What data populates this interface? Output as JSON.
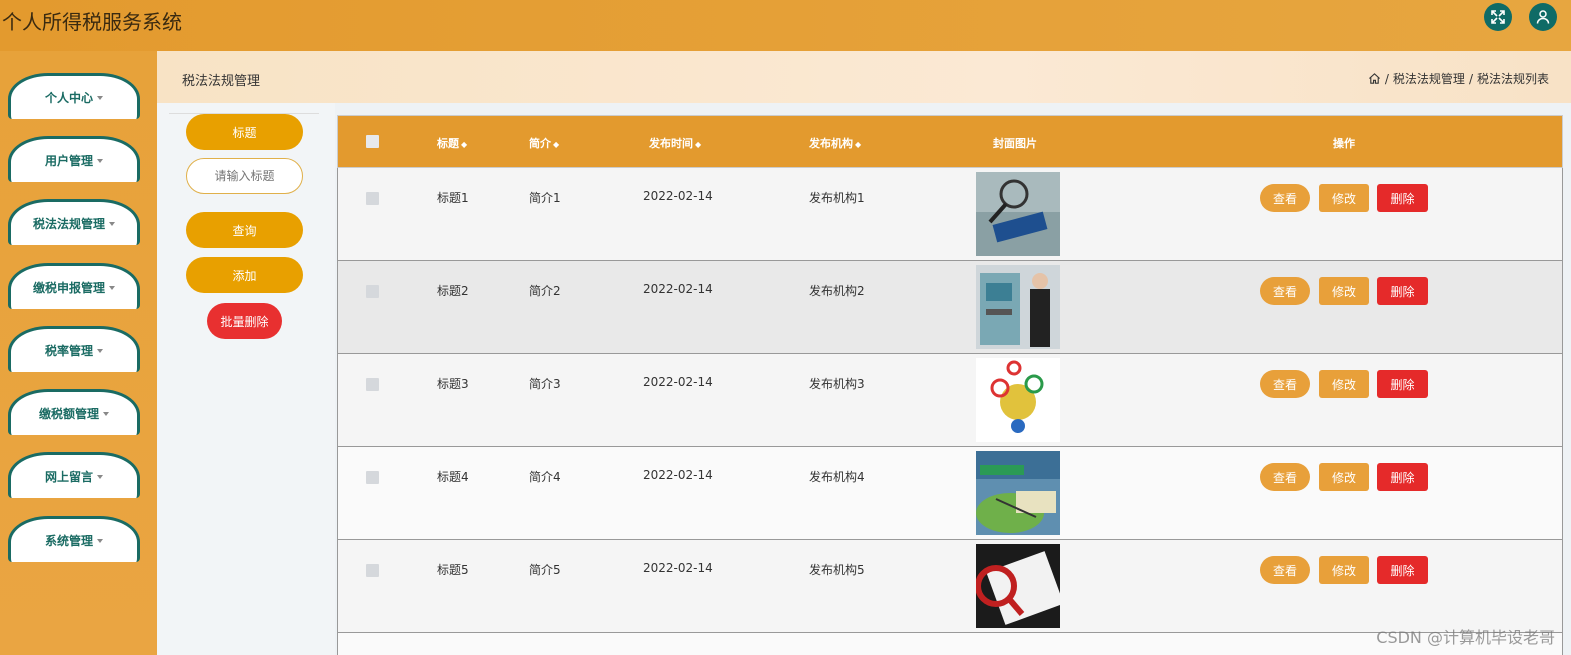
{
  "app": {
    "title": "个人所得税服务系统"
  },
  "topbar": {
    "fullscreen_icon": "fullscreen-icon",
    "user_icon": "user-icon",
    "icon_bg": "#0f6b66"
  },
  "sidebar": {
    "items": [
      {
        "label": "个人中心"
      },
      {
        "label": "用户管理"
      },
      {
        "label": "税法法规管理"
      },
      {
        "label": "缴税申报管理"
      },
      {
        "label": "税率管理"
      },
      {
        "label": "缴税额管理"
      },
      {
        "label": "网上留言"
      },
      {
        "label": "系统管理"
      }
    ]
  },
  "header": {
    "title": "税法法规管理",
    "breadcrumb": {
      "home_icon": "home-icon",
      "level1": "税法法规管理",
      "sep": "/",
      "level2": "税法法规列表"
    }
  },
  "filter": {
    "field_label": "标题",
    "input_placeholder": "请输入标题",
    "search_button": "查询",
    "add_button": "添加",
    "batch_delete_button": "批量删除"
  },
  "table": {
    "columns": {
      "title": "标题",
      "summary": "简介",
      "date": "发布时间",
      "org": "发布机构",
      "cover": "封面图片",
      "actions": "操作"
    },
    "sort_icon": "◆",
    "rows": [
      {
        "title": "标题1",
        "summary": "简介1",
        "date": "2022-02-14",
        "org": "发布机构1"
      },
      {
        "title": "标题2",
        "summary": "简介2",
        "date": "2022-02-14",
        "org": "发布机构2"
      },
      {
        "title": "标题3",
        "summary": "简介3",
        "date": "2022-02-14",
        "org": "发布机构3"
      },
      {
        "title": "标题4",
        "summary": "简介4",
        "date": "2022-02-14",
        "org": "发布机构4"
      },
      {
        "title": "标题5",
        "summary": "简介5",
        "date": "2022-02-14",
        "org": "发布机构5"
      }
    ],
    "row_actions": {
      "view": "查看",
      "edit": "修改",
      "delete": "删除"
    }
  },
  "colors": {
    "accent": "#e39a2e",
    "sidebar_border": "#1a6b63",
    "danger": "#e52a2a",
    "button": "#e8a03a"
  },
  "watermark": "CSDN @计算机毕设老哥"
}
